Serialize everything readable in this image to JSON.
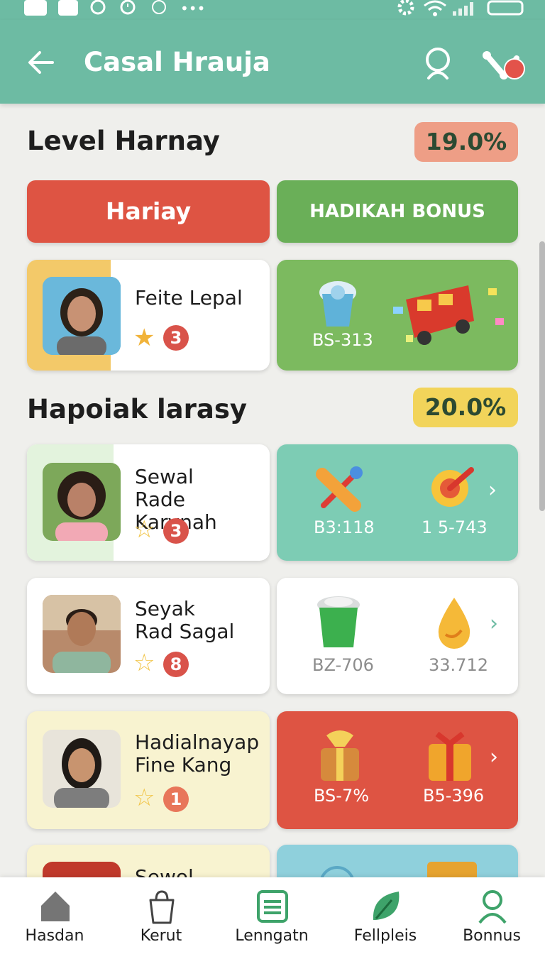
{
  "status_bar": {
    "icons": [
      "app-icon",
      "plus-box-icon",
      "circle-icon",
      "alarm-icon",
      "circle-outline-icon",
      "more-dots-icon",
      "settings-gear-icon",
      "wifi-icon",
      "signal-icon",
      "battery-icon"
    ]
  },
  "header": {
    "title": "Casal Hrauja",
    "back_icon": "arrow-left-icon",
    "search_icon": "search-icon",
    "share_icon": "share-icon"
  },
  "level_section": {
    "title": "Level Harnay",
    "percent": "19.0%",
    "percent_color": "#ee9e86",
    "tabs": [
      {
        "label": "Hariay",
        "color": "#de5443"
      },
      {
        "label": "HADIKAH BONUS",
        "color": "#6aaf58"
      }
    ],
    "player": {
      "name": "Feite Lepal",
      "rank": "3"
    },
    "reward": {
      "label": "BS-313",
      "items": [
        "cup-icon",
        "bus-icon"
      ]
    }
  },
  "happy_section": {
    "title": "Hapoiak larasy",
    "percent": "20.0%",
    "percent_color": "#f2d45a",
    "rows": [
      {
        "name_line1": "Sewal",
        "name_line2": "Rade Karynah",
        "rank": "3",
        "reward_left_label": "B3:118",
        "reward_right_label": "1 5-743",
        "reward_bg": "#7dccb4",
        "label_color": "#ffffff",
        "left_icon": "bone-icon",
        "right_icon": "target-icon",
        "tint": "#e3f3dd"
      },
      {
        "name_line1": "Seyak",
        "name_line2": "Rad Sagal",
        "rank": "8",
        "reward_left_label": "BZ-706",
        "reward_right_label": "33.712",
        "reward_bg": "#ffffff",
        "label_color": "#8d8d8d",
        "left_icon": "cup-icon",
        "right_icon": "drop-icon",
        "tint": "#ffffff"
      },
      {
        "name_line1": "Hadialnayap",
        "name_line2": "Fine Kang",
        "rank": "1",
        "reward_left_label": "BS-7%",
        "reward_right_label": "B5-396",
        "reward_bg": "#de5443",
        "label_color": "#ffffff",
        "left_icon": "gift-box-icon",
        "right_icon": "gift-icon",
        "tint": "#f8f3d0"
      }
    ],
    "partial_row": {
      "name_line1": "Sewol"
    }
  },
  "bottom_nav": [
    {
      "label": "Hasdan",
      "icon": "home-icon"
    },
    {
      "label": "Kerut",
      "icon": "bag-icon"
    },
    {
      "label": "Lenngatn",
      "icon": "grid-list-icon"
    },
    {
      "label": "Fellpleis",
      "icon": "leaf-icon"
    },
    {
      "label": "Bonnus",
      "icon": "person-icon"
    }
  ]
}
